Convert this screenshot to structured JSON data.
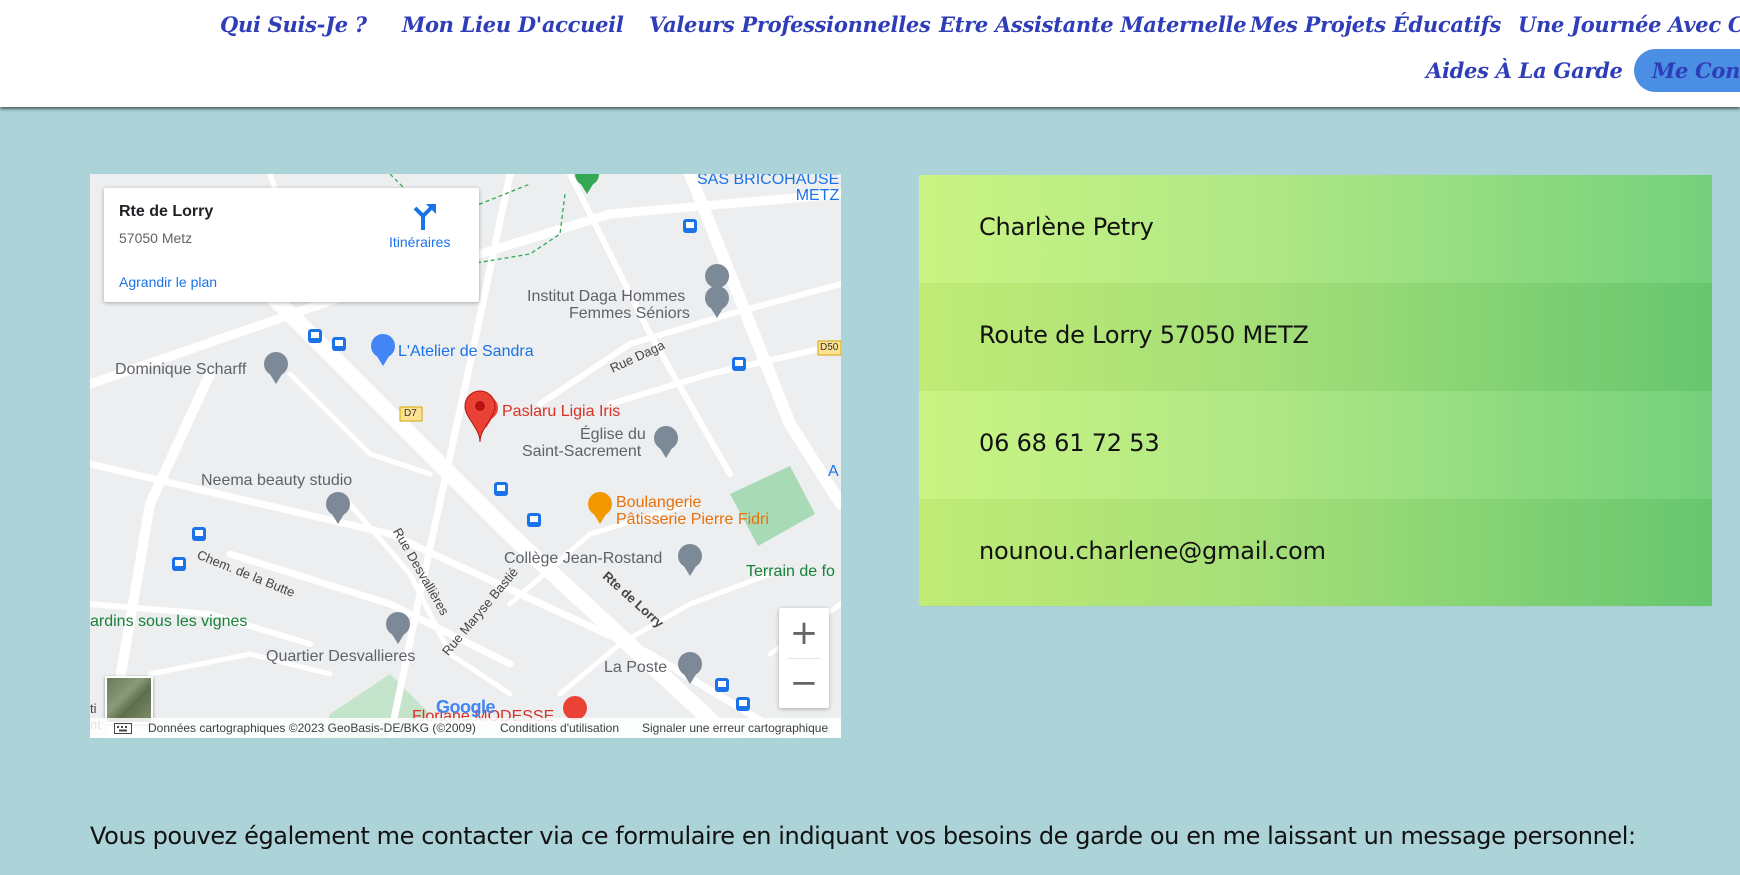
{
  "nav": {
    "row1": [
      "Qui Suis-Je ?",
      "Mon Lieu D'accueil",
      "Valeurs Professionnelles",
      "Etre Assistante Maternelle",
      "Mes Projets Éducatifs",
      "Une Journée Avec Char"
    ],
    "row2": [
      "Aides À La Garde",
      "Me Conta"
    ]
  },
  "map": {
    "place_title": "Rte de Lorry",
    "place_address": "57050 Metz",
    "enlarge_link": "Agrandir le plan",
    "directions_label": "Itinéraires",
    "poi_labels": {
      "bricohause": "SAS BRICOHAUSE\nMETZ",
      "daga_1": "Institut Daga Hommes",
      "daga_2": "Femmes Séniors",
      "atelier": "L'Atelier de Sandra",
      "scharff": "Dominique Scharff",
      "paslaru": "Paslaru Ligia Iris",
      "eglise_1": "Église du",
      "eglise_2": "Saint-Sacrement",
      "neema": "Neema beauty studio",
      "boulangerie_1": "Boulangerie",
      "boulangerie_2": "Pâtisserie Pierre Fidri",
      "college": "Collège Jean-Rostand",
      "terrain": "Terrain de fo",
      "jardins": "ardins sous les vignes",
      "quartier": "Quartier Desvallieres",
      "poste": "La Poste",
      "floriane": "Floriane MODESSE",
      "a_edge": "A"
    },
    "street_labels": {
      "rue_daga": "Rue Daga",
      "chem_butte": "Chem. de la Butte",
      "rue_desvallieres": "Rue Desvallières",
      "rue_bastie": "Rue Maryse Bastié",
      "rte_lorry": "Rte de Lorry",
      "d7": "D7",
      "d50": "D50",
      "edge_ti": "ti",
      "edge_nt": "nt"
    },
    "zoom_in": "+",
    "zoom_out": "−",
    "google_logo": "Google",
    "footer": {
      "data_credit": "Données cartographiques ©2023 GeoBasis-DE/BKG (©2009)",
      "terms": "Conditions d'utilisation",
      "report": "Signaler une erreur cartographique"
    }
  },
  "contact": {
    "name": "Charlène Petry",
    "address": "Route de Lorry 57050 METZ",
    "phone": "06 68 61 72 53",
    "email": "nounou.charlene@gmail.com"
  },
  "intro_text": "Vous pouvez également me contacter via ce formulaire en indiquant vos besoins de garde ou en me laissant un message personnel:",
  "colors": {
    "background": "#acd3d8",
    "nav_text": "#2f3eb8",
    "nav_active_bg": "#4a8fe3",
    "contact_gradient_start": "#c7f37a",
    "contact_gradient_end": "#6acd73"
  }
}
